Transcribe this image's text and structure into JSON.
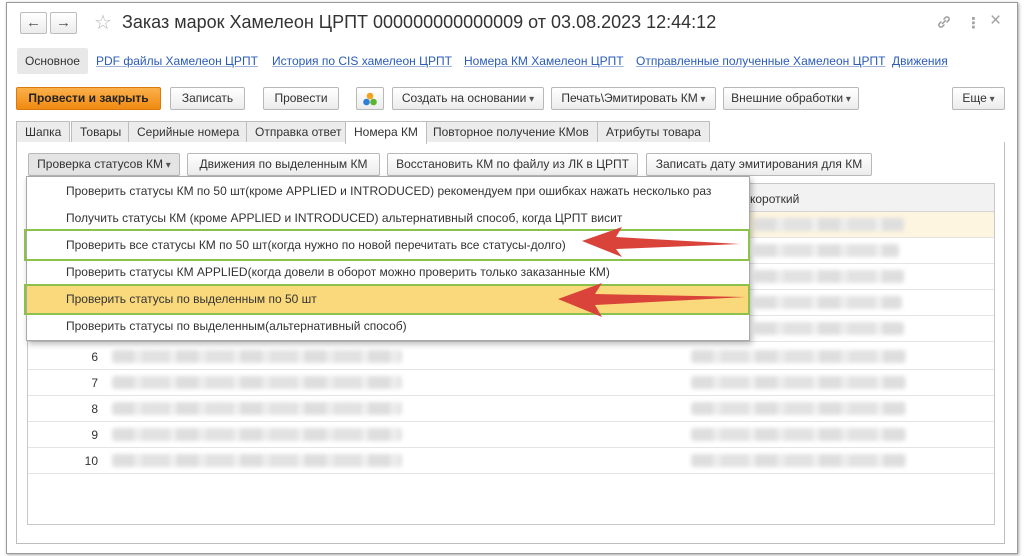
{
  "window": {
    "title": "Заказ марок Хамелеон ЦРПТ 000000000000009 от 03.08.2023 12:44:12",
    "back_glyph": "←",
    "forward_glyph": "→",
    "star_glyph": "☆",
    "link_glyph": "🔗",
    "more_glyph": "⋮",
    "close_glyph": "×"
  },
  "sections": {
    "main": "Основное",
    "links": [
      "PDF файлы  Хамелеон ЦРПТ",
      "История по CIS хамелеон ЦРПТ",
      "Номера КМ Хамелеон ЦРПТ",
      "Отправленные полученные Хамелеон ЦРПТ",
      "Движения"
    ]
  },
  "toolbar": {
    "post_close": "Провести и закрыть",
    "save": "Записать",
    "post": "Провести",
    "create_basis": "Создать на основании",
    "print": "Печать\\Эмитировать КМ",
    "external": "Внешние обработки",
    "more": "Еще"
  },
  "tabs": [
    "Шапка",
    "Товары",
    "Серийные номера",
    "Отправка ответ",
    "Номера КМ",
    "Повторное получение КМов",
    "Атрибуты товара"
  ],
  "active_tab": "Номера КМ",
  "subtoolbar": {
    "check_statuses": "Проверка статусов КМ",
    "movements": "Движения по выделенным КМ",
    "restore": "Восстановить КМ по файлу из ЛК в ЦРПТ",
    "write_date": "Записать дату эмитирования для КМ"
  },
  "grid": {
    "col_short": "короткий",
    "row_numbers": [
      "6",
      "7",
      "8",
      "9",
      "10"
    ]
  },
  "menu": {
    "items": [
      "Проверить статусы КМ по 50 шт(кроме APPLIED и INTRODUCED) рекомендуем при ошибках нажать несколько раз",
      "Получить статусы КМ (кроме APPLIED и INTRODUCED) альтернативный способ, когда ЦРПТ висит",
      "Проверить все статусы КМ по 50 шт(когда нужно по новой перечитать все статусы-долго)",
      "Проверить статусы КМ APPLIED(когда довели в оборот можно проверить только заказанные КМ)",
      "Проверить статусы по выделенным по 50 шт",
      "Проверить статусы по выделенным(альтернативный способ)"
    ],
    "highlighted_index": 4,
    "boxed_indices": [
      2,
      4
    ]
  },
  "colors": {
    "primary_button": "#f08a12",
    "highlight": "#fad97c",
    "box_border": "#8cc14c",
    "arrow": "#d9433a",
    "link": "#2a5bb8"
  }
}
